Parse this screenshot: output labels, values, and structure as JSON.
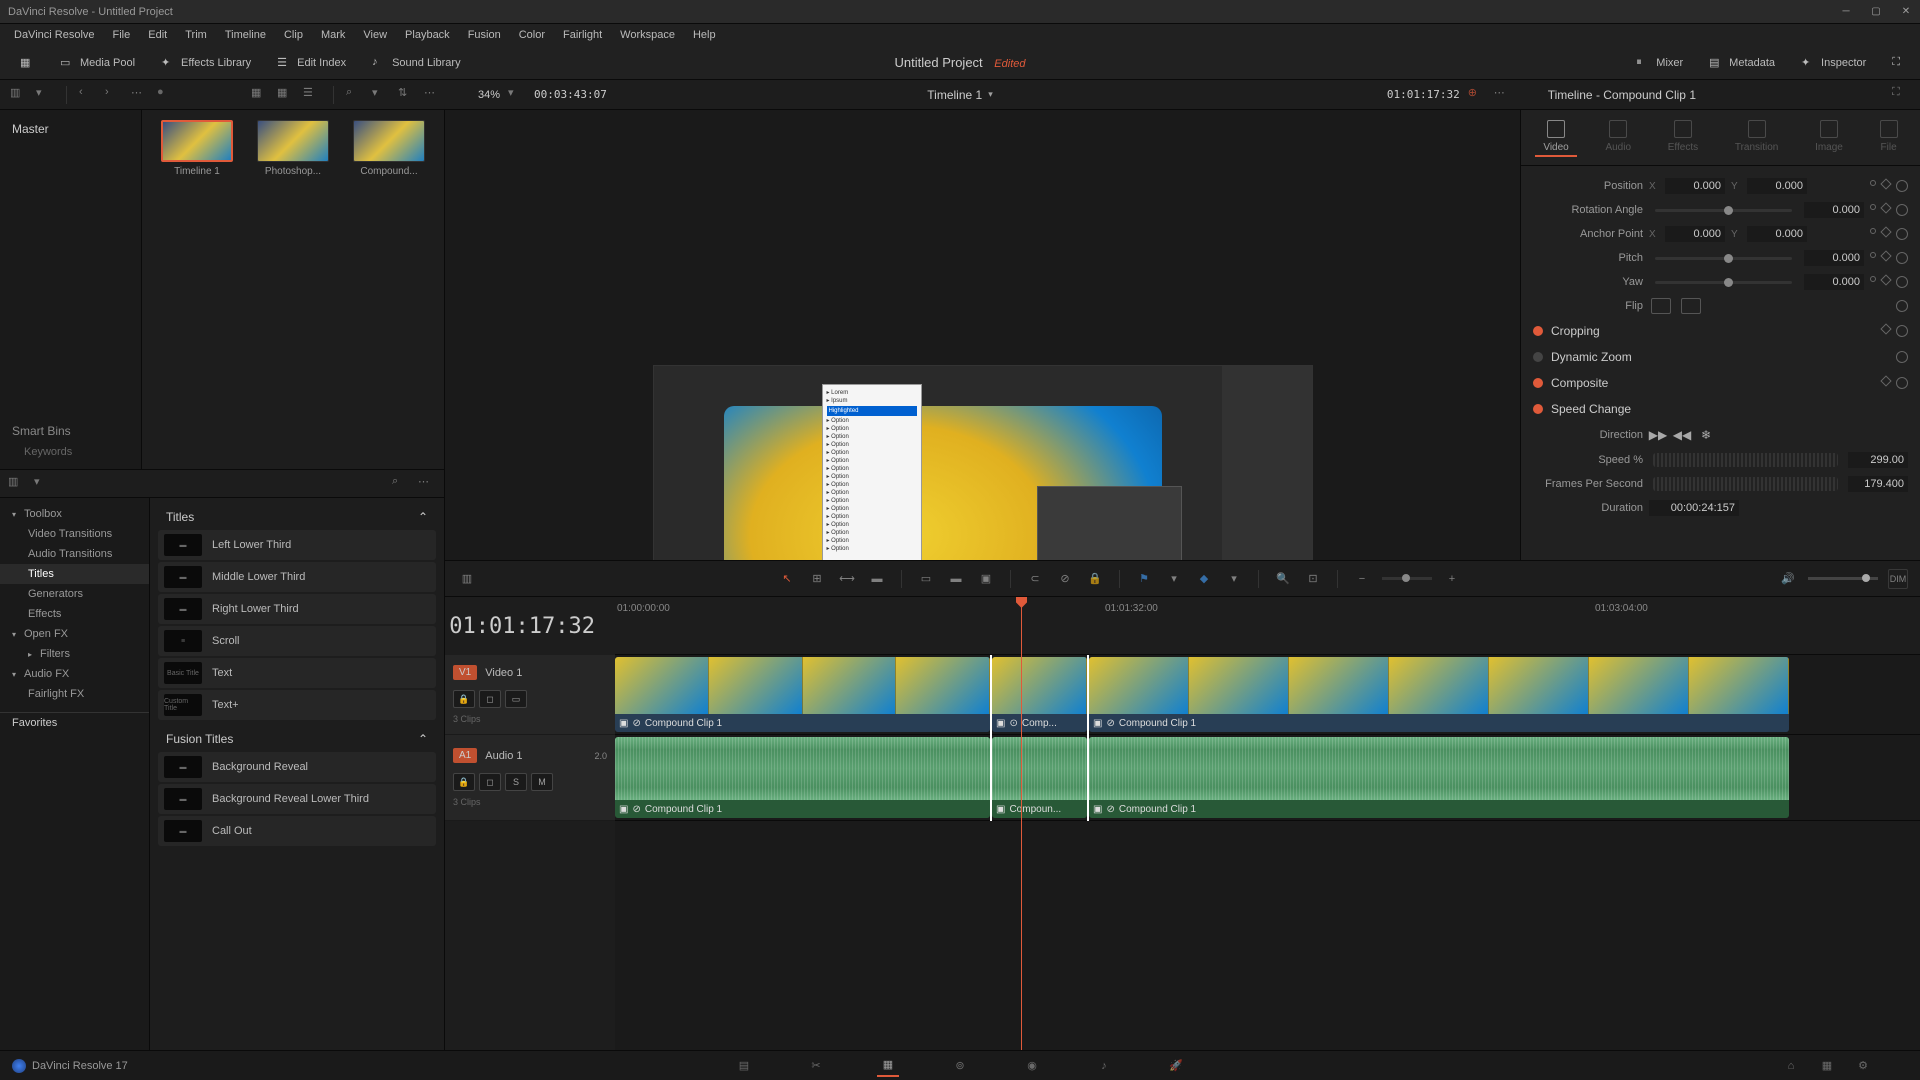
{
  "window": {
    "title": "DaVinci Resolve - Untitled Project"
  },
  "menu": [
    "DaVinci Resolve",
    "File",
    "Edit",
    "Trim",
    "Timeline",
    "Clip",
    "Mark",
    "View",
    "Playback",
    "Fusion",
    "Color",
    "Fairlight",
    "Workspace",
    "Help"
  ],
  "toolbar": {
    "media_pool": "Media Pool",
    "effects_library": "Effects Library",
    "edit_index": "Edit Index",
    "sound_library": "Sound Library",
    "project_title": "Untitled Project",
    "edited": "Edited",
    "mixer": "Mixer",
    "metadata": "Metadata",
    "inspector": "Inspector"
  },
  "secondary": {
    "zoom_pct": "34%",
    "source_tc": "00:03:43:07",
    "timeline_name": "Timeline 1",
    "record_tc": "01:01:17:32"
  },
  "media_pool": {
    "master": "Master",
    "smart_bins": "Smart Bins",
    "keywords": "Keywords",
    "clips": [
      {
        "label": "Timeline 1",
        "selected": true
      },
      {
        "label": "Photoshop..."
      },
      {
        "label": "Compound..."
      }
    ]
  },
  "effects_tree": {
    "toolbox": "Toolbox",
    "video_trans": "Video Transitions",
    "audio_trans": "Audio Transitions",
    "titles": "Titles",
    "generators": "Generators",
    "effects": "Effects",
    "openfx": "Open FX",
    "filters": "Filters",
    "audiofx": "Audio FX",
    "fairlightfx": "Fairlight FX",
    "favorites": "Favorites"
  },
  "titles_list": {
    "header": "Titles",
    "items": [
      "Left Lower Third",
      "Middle Lower Third",
      "Right Lower Third",
      "Scroll",
      "Text",
      "Text+"
    ],
    "fusion_header": "Fusion Titles",
    "fusion_items": [
      "Background Reveal",
      "Background Reveal Lower Third",
      "Call Out"
    ]
  },
  "inspector": {
    "header": "Timeline - Compound Clip 1",
    "tabs": [
      "Video",
      "Audio",
      "Effects",
      "Transition",
      "Image",
      "File"
    ],
    "position": {
      "label": "Position",
      "x": "0.000",
      "y": "0.000"
    },
    "rotation": {
      "label": "Rotation Angle",
      "val": "0.000"
    },
    "anchor": {
      "label": "Anchor Point",
      "x": "0.000",
      "y": "0.000"
    },
    "pitch": {
      "label": "Pitch",
      "val": "0.000"
    },
    "yaw": {
      "label": "Yaw",
      "val": "0.000"
    },
    "flip": {
      "label": "Flip"
    },
    "cropping": "Cropping",
    "dynzoom": "Dynamic Zoom",
    "composite": "Composite",
    "speed": "Speed Change",
    "direction": "Direction",
    "speed_pct": {
      "label": "Speed %",
      "val": "299.00"
    },
    "fps": {
      "label": "Frames Per Second",
      "val": "179.400"
    },
    "duration": {
      "label": "Duration",
      "val": "00:00:24:157"
    }
  },
  "timeline": {
    "tc": "01:01:17:32",
    "ruler": [
      "01:00:00:00",
      "01:01:32:00",
      "01:03:04:00"
    ],
    "v1": {
      "tag": "V1",
      "name": "Video 1",
      "clips_info": "3 Clips"
    },
    "a1": {
      "tag": "A1",
      "name": "Audio 1",
      "ch": "2.0",
      "clips_info": "3 Clips",
      "s": "S",
      "m": "M"
    },
    "clip_label": "Compound Clip 1",
    "clip_label_short": "Comp...",
    "clip_label_mid": "Compoun..."
  },
  "bottom": {
    "app": "DaVinci Resolve 17"
  }
}
